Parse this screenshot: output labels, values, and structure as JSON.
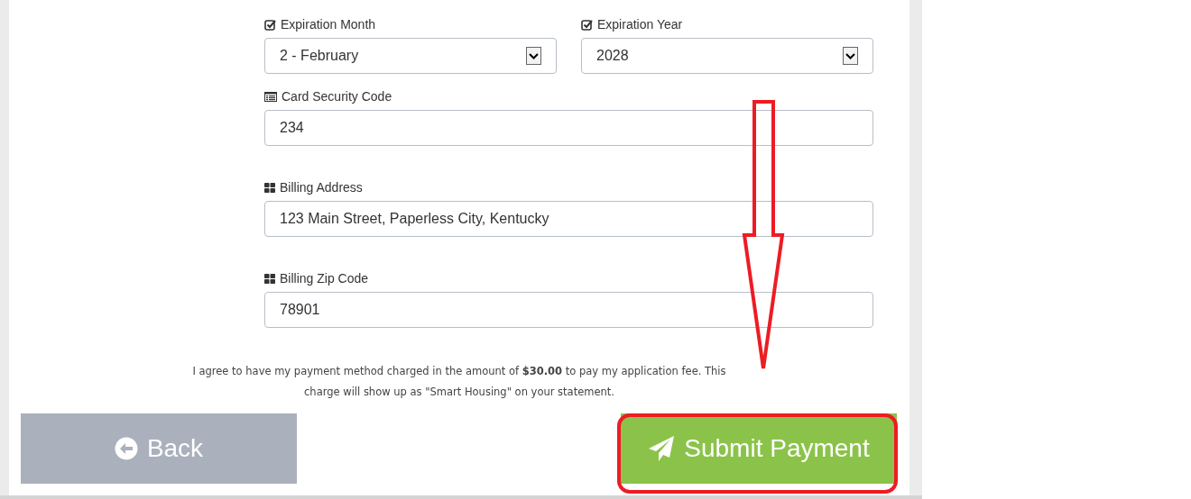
{
  "expiration": [
    {
      "label": "Expiration Month",
      "value": "2 - February"
    },
    {
      "label": "Expiration Year",
      "value": "2028"
    }
  ],
  "fields": [
    {
      "label": "Card Security Code",
      "kind": "list",
      "value": "234"
    },
    {
      "label": "Billing Address",
      "kind": "grid",
      "value": "123 Main Street, Paperless City, Kentucky"
    },
    {
      "label": "Billing Zip Code",
      "kind": "grid",
      "value": "78901"
    }
  ],
  "agreement": "I agree to have my payment method charged in the amount of **$30.00** to pay my application fee. This charge will show up as \"Smart Housing\" on your statement.",
  "buttons": [
    {
      "kind": "back",
      "label": "Back"
    },
    {
      "kind": "submit",
      "label": "Submit Payment"
    }
  ]
}
